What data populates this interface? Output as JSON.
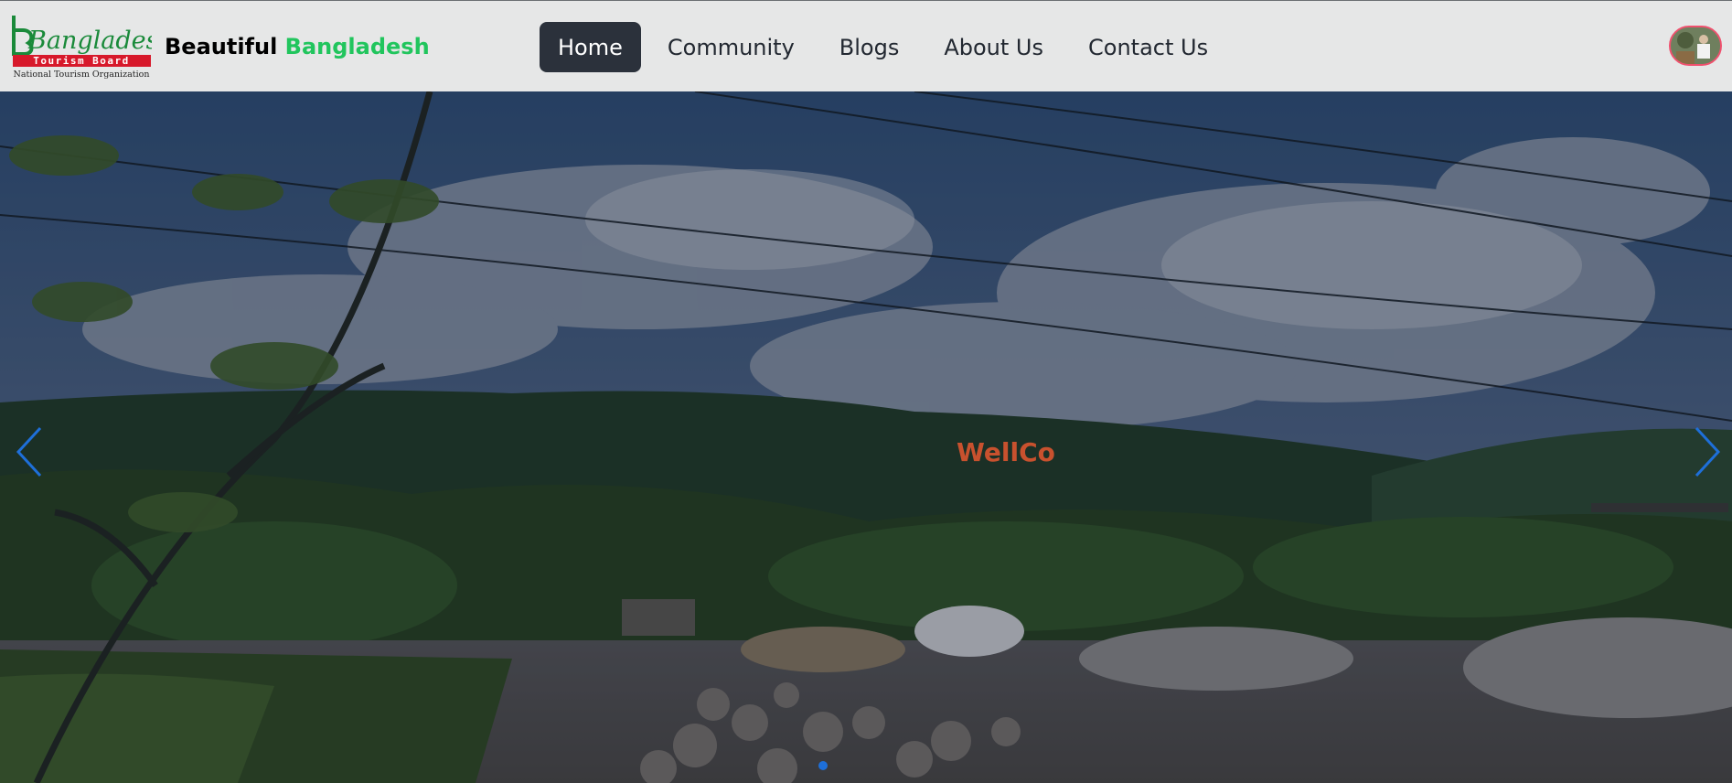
{
  "header": {
    "logo": {
      "main_text": "Bangladesh",
      "band_text": "Tourism Board",
      "sub_text": "National Tourism Organization",
      "colors": {
        "green": "#1a8a3a",
        "red": "#d7192b"
      }
    },
    "brand": {
      "part1": "Beautiful",
      "part2": "Bangladesh",
      "accent": "#21c55d"
    },
    "nav": [
      {
        "label": "Home",
        "active": true
      },
      {
        "label": "Community",
        "active": false
      },
      {
        "label": "Blogs",
        "active": false
      },
      {
        "label": "About Us",
        "active": false
      },
      {
        "label": "Contact Us",
        "active": false
      }
    ],
    "avatar_icon": "user-avatar-icon"
  },
  "hero": {
    "text": "WellCo",
    "text_color": "#c8512e",
    "prev_icon": "chevron-left-icon",
    "next_icon": "chevron-right-icon",
    "arrow_color": "#1e6fd9",
    "slides_count": 1,
    "active_slide": 1
  }
}
